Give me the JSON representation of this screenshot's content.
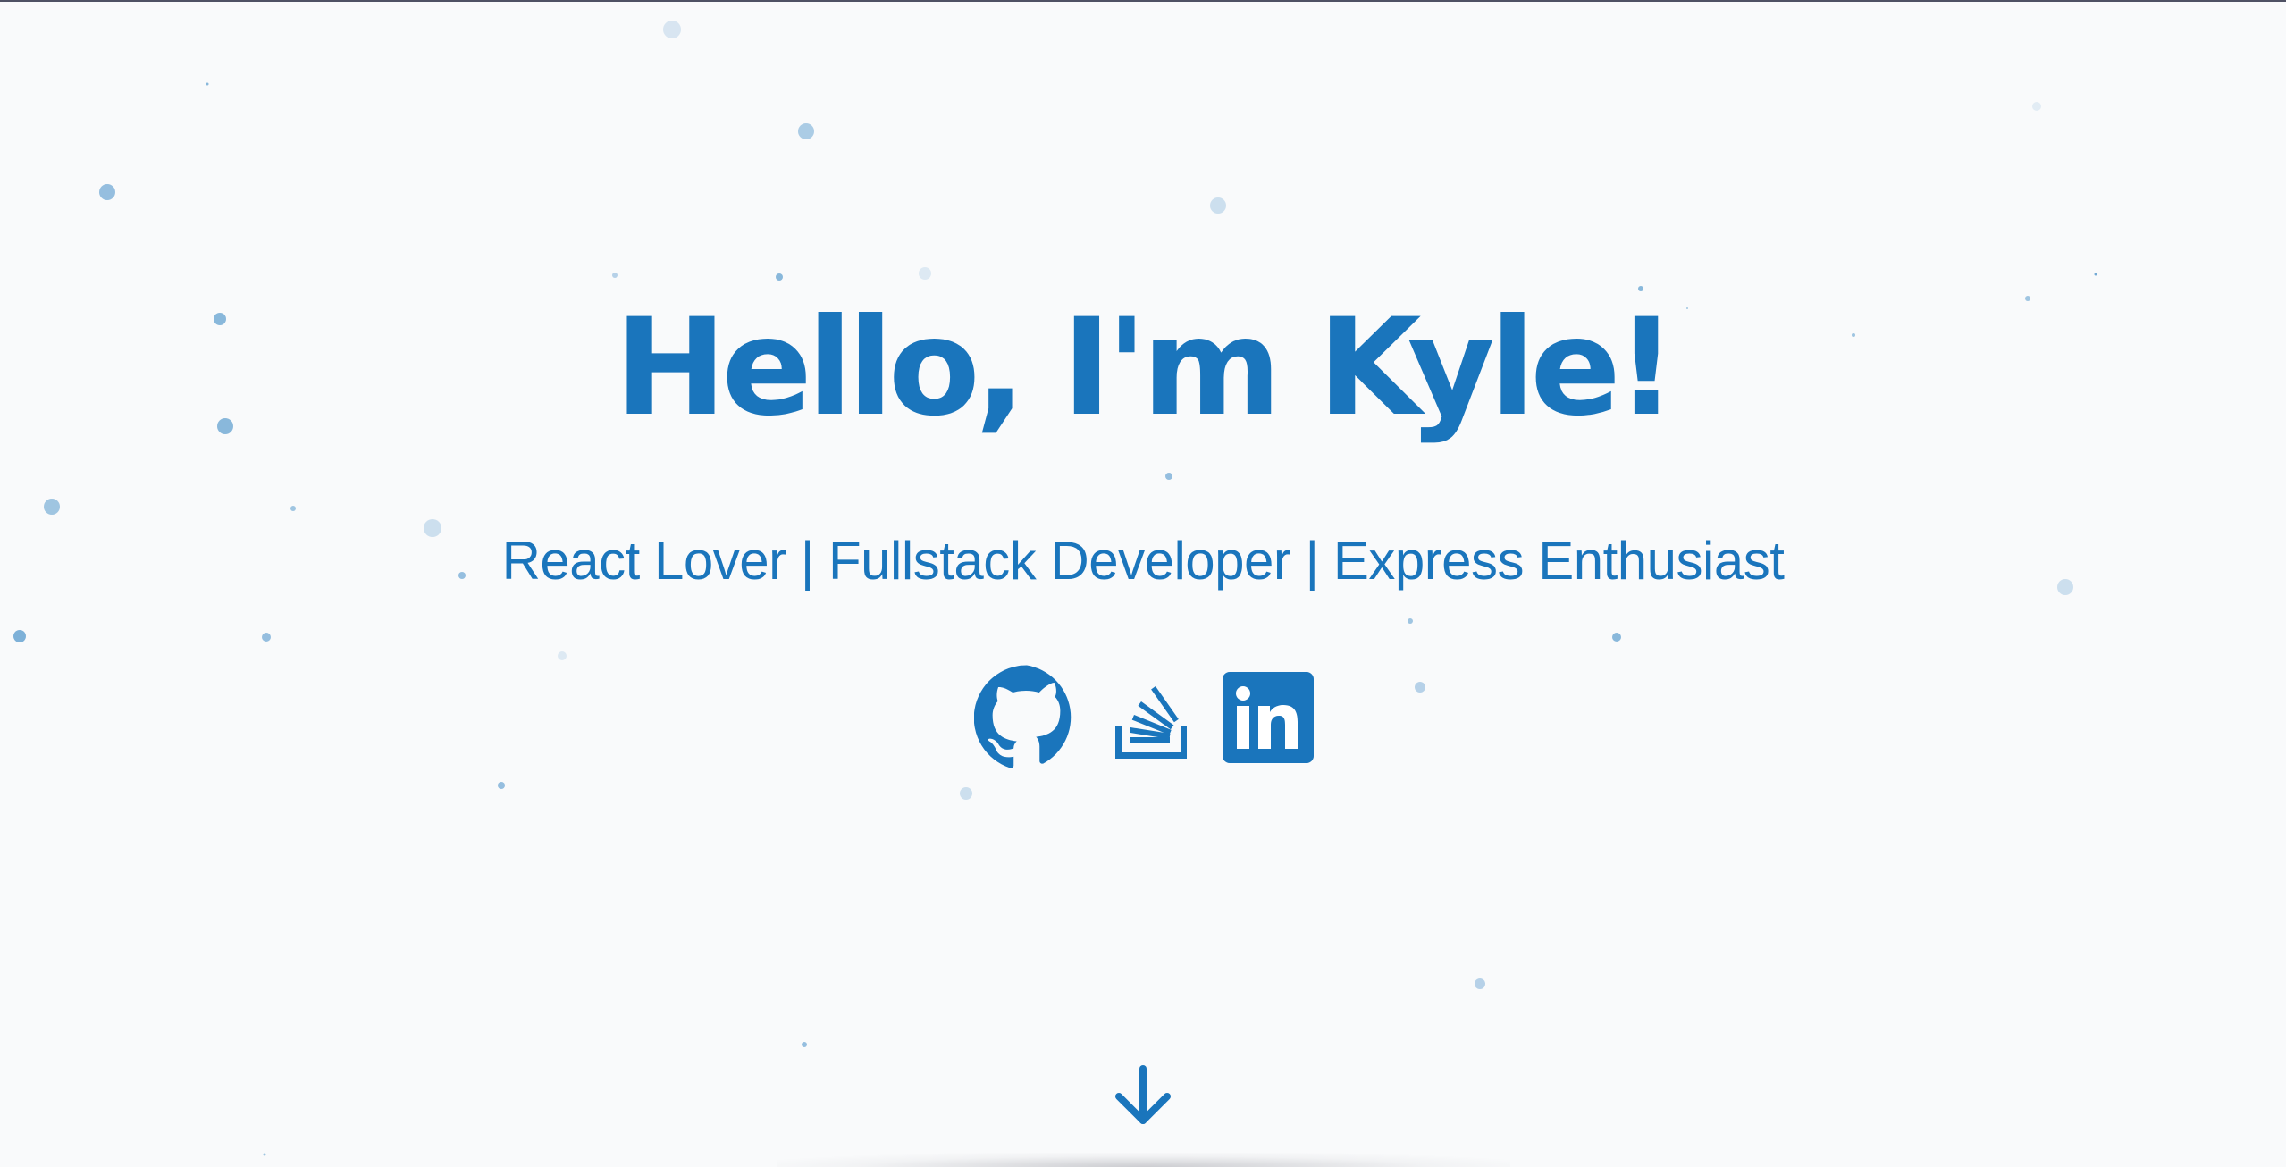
{
  "hero": {
    "title": "Hello, I'm Kyle!",
    "subtitle": "React Lover | Fullstack Developer | Express Enthusiast"
  },
  "social_links": [
    {
      "name": "GitHub",
      "icon": "github-icon"
    },
    {
      "name": "Stack Overflow",
      "icon": "stackoverflow-icon"
    },
    {
      "name": "LinkedIn",
      "icon": "linkedin-icon"
    }
  ],
  "scroll_indicator": {
    "icon": "arrow-down-icon"
  },
  "colors": {
    "accent": "#1a75bc",
    "background": "#f9fafb",
    "particle": "#1a75bc"
  }
}
